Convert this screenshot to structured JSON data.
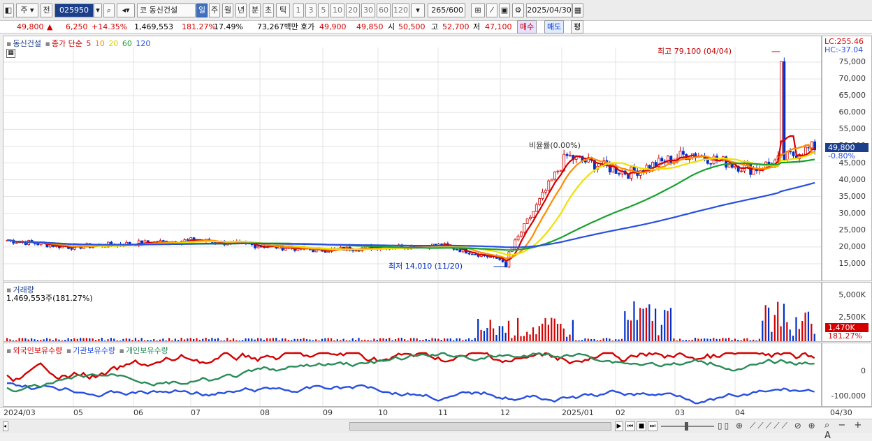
{
  "toolbar": {
    "market": "주",
    "prev": "전",
    "code": "025950",
    "stock_name": "동신건설",
    "prefix": "코",
    "periods": [
      "일",
      "주",
      "월",
      "년",
      "분",
      "초",
      "틱"
    ],
    "intervals": [
      "1",
      "3",
      "5",
      "10",
      "20",
      "30",
      "60",
      "120"
    ],
    "count": "265",
    "count_max": "/600",
    "date": "2025/04/30"
  },
  "quote": {
    "price": "49,800",
    "change_arrow": "▲",
    "change": "6,250",
    "change_pct": "+14.35%",
    "volume": "1,469,553",
    "vol_ratio": "181.27%",
    "turnover": "17.49%",
    "amount": "73,267백만",
    "ask_label": "호가",
    "ask": "49,900",
    "bid": "49,850",
    "open_label": "시",
    "open": "50,500",
    "high_label": "고",
    "high": "52,700",
    "low_label": "저",
    "low": "47,100",
    "buy_label": "매수",
    "sell_label": "매도",
    "avg_label": "평"
  },
  "price_pane": {
    "legend_name": "동신건설",
    "legend_type": "종가 단순",
    "ma_periods": [
      "5",
      "10",
      "20",
      "60",
      "120"
    ],
    "ma_colors": [
      "#d40000",
      "#ff8c00",
      "#f0e000",
      "#18a030",
      "#2850e0"
    ],
    "lc": "LC:255.46",
    "hc": "HC:-37.04",
    "current_price_tag": "49,800",
    "current_pct_tag": "-0.80%",
    "high_annotation": "최고 79,100 (04/04)",
    "low_annotation": "최저 14,010 (11/20)",
    "overlay_text": "비율률(0.00%)",
    "y_ticks": [
      "75,000",
      "70,000",
      "65,000",
      "60,000",
      "55,000",
      "50,000",
      "45,000",
      "40,000",
      "35,000",
      "30,000",
      "25,000",
      "20,000",
      "15,000"
    ]
  },
  "volume_pane": {
    "title": "거래량",
    "value": "1,469,553주(181.27%)",
    "y_ticks": [
      "5,000K",
      "2,500K"
    ],
    "current_tag": "1,470K",
    "current_pct": "181.27%"
  },
  "holding_pane": {
    "series": [
      "외국인보유수량",
      "기관보유수량",
      "개인보유수량"
    ],
    "series_colors": [
      "#d40000",
      "#2850e0",
      "#2a8c5a"
    ],
    "y_ticks": [
      "0",
      "-100,000"
    ]
  },
  "x_axis": {
    "labels": [
      "2024/03",
      "05",
      "06",
      "07",
      "08",
      "09",
      "10",
      "11",
      "12",
      "2025/01",
      "02",
      "03",
      "04"
    ],
    "end_label": "04/30"
  },
  "chart_data": {
    "type": "candlestick",
    "title": "동신건설",
    "y_unit": "KRW",
    "ylim": [
      12000,
      80000
    ],
    "monthly_closes_approx": [
      {
        "month": "2024/03",
        "close": 22000
      },
      {
        "month": "2024/04",
        "close": 20000
      },
      {
        "month": "2024/05",
        "close": 21000
      },
      {
        "month": "2024/06",
        "close": 22000
      },
      {
        "month": "2024/07",
        "close": 20500
      },
      {
        "month": "2024/08",
        "close": 19000
      },
      {
        "month": "2024/09",
        "close": 20000
      },
      {
        "month": "2024/10",
        "close": 20500
      },
      {
        "month": "2024/11",
        "close": 16000
      },
      {
        "month": "2024/12",
        "close": 47000
      },
      {
        "month": "2025/01",
        "close": 42000
      },
      {
        "month": "2025/02",
        "close": 48000
      },
      {
        "month": "2025/03",
        "close": 43000
      },
      {
        "month": "2025/04",
        "close": 49800
      }
    ],
    "high": {
      "value": 79100,
      "date": "04/04"
    },
    "low": {
      "value": 14010,
      "date": "11/20"
    }
  }
}
